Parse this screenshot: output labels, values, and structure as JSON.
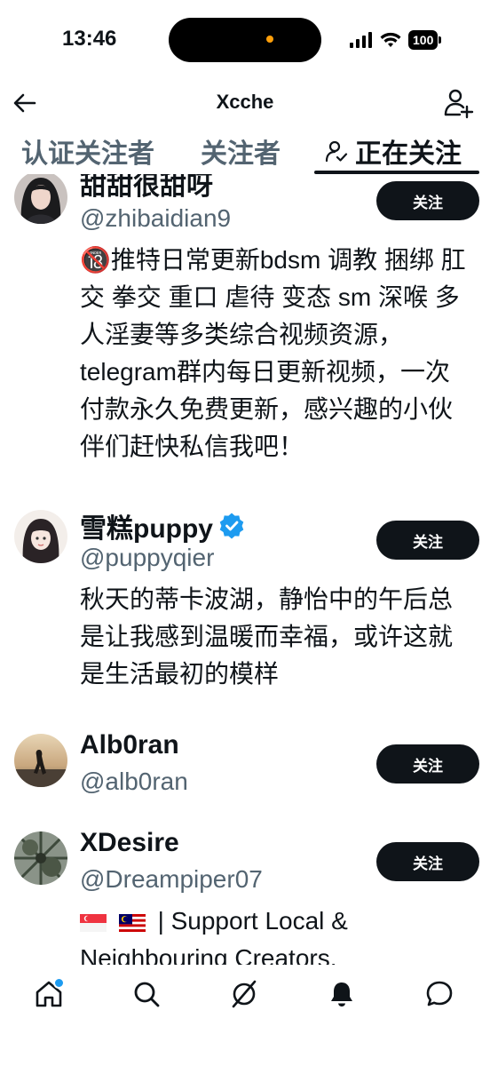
{
  "status_bar": {
    "time": "13:46",
    "battery": "100"
  },
  "header": {
    "title": "Xcche"
  },
  "tabs": [
    {
      "label": "认证关注者"
    },
    {
      "label": "关注者"
    },
    {
      "label": "正在关注"
    }
  ],
  "users": [
    {
      "display_name": "甜甜很甜呀",
      "handle": "@zhibaidian9",
      "bio": "🔞推特日常更新bdsm 调教 捆绑 肛交 拳交 重口 虐待 变态 sm 深喉 多人淫妻等多类综合视频资源，telegram群内每日更新视频，一次付款永久免费更新，感兴趣的小伙伴们赶快私信我吧！",
      "follow_label": "关注"
    },
    {
      "display_name": "雪糕puppy",
      "handle": "@puppyqier",
      "bio": "秋天的蒂卡波湖，静怡中的午后总是让我感到温暖而幸福，或许这就是生活最初的模样",
      "follow_label": "关注",
      "verified": true
    },
    {
      "display_name": "Alb0ran",
      "handle": "@alb0ran",
      "follow_label": "关注"
    },
    {
      "display_name": "XDesire",
      "handle": "@Dreampiper07",
      "bio": "| Support Local & Neighbouring Creators.",
      "follow_label": "关注"
    }
  ],
  "colors": {
    "accent": "#1d9bf0",
    "text": "#0f1419",
    "secondary": "#536471"
  }
}
